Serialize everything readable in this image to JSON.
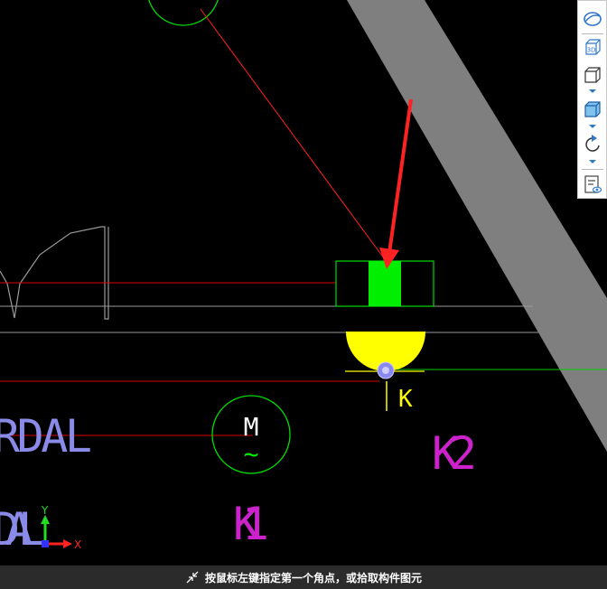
{
  "drawing": {
    "text_rdal_1": "RDAL",
    "text_rdal_2": "DAL",
    "motor_letter": "M",
    "motor_symbol": "~",
    "label_k1": "K1",
    "label_k2": "K2",
    "label_k": "K",
    "axis_x": "X",
    "axis_y": "Y"
  },
  "toolbar": {
    "items": [
      {
        "icon": "orbit-icon"
      },
      {
        "icon": "3d-view-icon",
        "label": "3D"
      },
      {
        "icon": "cube-view-icon"
      },
      {
        "icon": "cube-shaded-icon"
      },
      {
        "icon": "rotate-icon"
      },
      {
        "icon": "properties-view-icon"
      }
    ]
  },
  "status": {
    "prompt": "按鼠标左键指定第一个角点，或拾取构件图元"
  },
  "colors": {
    "background": "#000000",
    "red_line": "#ff0000",
    "green_component": "#00ff00",
    "yellow_lamp": "#ffff00",
    "magenta_text": "#cc22cc",
    "slate_text": "#8888dd",
    "gray_band": "#7f7f7f",
    "status_bg": "#2b2b2b"
  }
}
